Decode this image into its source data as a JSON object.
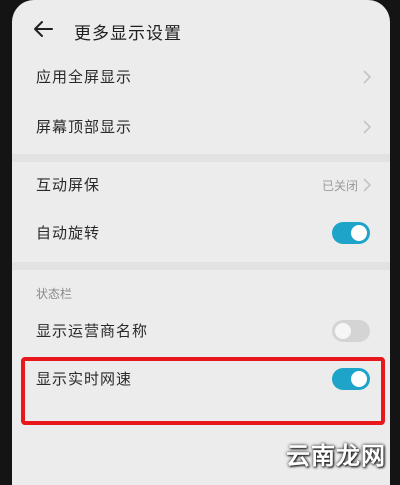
{
  "header": {
    "title": "更多显示设置",
    "back_icon": "back-arrow-icon"
  },
  "rows": [
    {
      "label": "应用全屏显示",
      "type": "chevron"
    },
    {
      "label": "屏幕顶部显示",
      "type": "chevron"
    },
    {
      "label": "互动屏保",
      "value": "已关闭",
      "type": "chevron"
    },
    {
      "label": "自动旋转",
      "type": "toggle",
      "checked": true
    }
  ],
  "status_bar_section": {
    "header": "状态栏",
    "rows": [
      {
        "label": "显示运营商名称",
        "type": "toggle",
        "checked": false
      },
      {
        "label": "显示实时网速",
        "type": "toggle",
        "checked": true
      }
    ]
  },
  "highlight": {
    "target": "显示实时网速",
    "color": "#e8171b"
  },
  "colors": {
    "toggle_on": "#1fa4c9",
    "toggle_off": "#d4d4d4",
    "background": "#ececec"
  },
  "watermark": "云南龙网"
}
